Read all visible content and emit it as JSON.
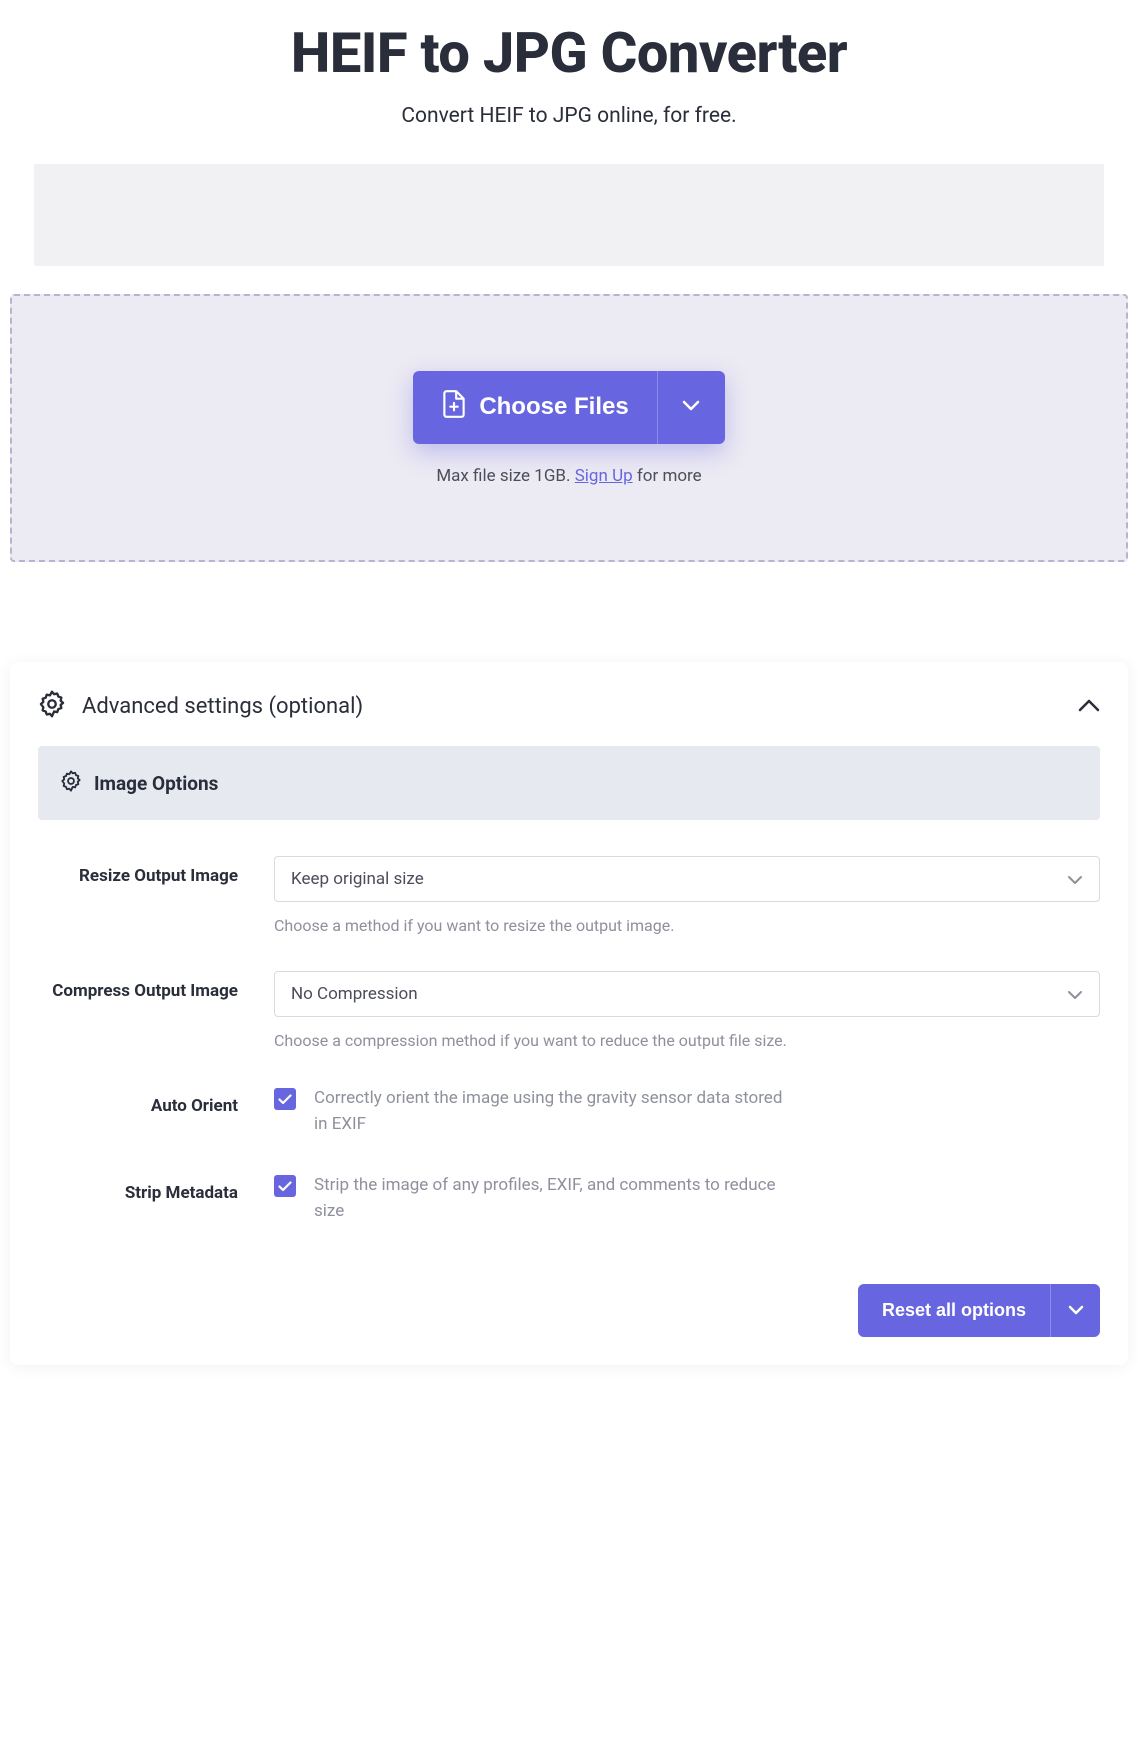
{
  "header": {
    "title": "HEIF to JPG Converter",
    "subtitle": "Convert HEIF to JPG online, for free."
  },
  "upload": {
    "choose_label": "Choose Files",
    "hint_prefix": "Max file size 1GB. ",
    "signup_label": "Sign Up",
    "hint_suffix": " for more"
  },
  "advanced": {
    "title": "Advanced settings (optional)",
    "section_title": "Image Options",
    "resize": {
      "label": "Resize Output Image",
      "value": "Keep original size",
      "help": "Choose a method if you want to resize the output image."
    },
    "compress": {
      "label": "Compress Output Image",
      "value": "No Compression",
      "help": "Choose a compression method if you want to reduce the output file size."
    },
    "auto_orient": {
      "label": "Auto Orient",
      "desc": "Correctly orient the image using the gravity sensor data stored in EXIF"
    },
    "strip_metadata": {
      "label": "Strip Metadata",
      "desc": "Strip the image of any profiles, EXIF, and comments to reduce size"
    },
    "reset_label": "Reset all options"
  }
}
